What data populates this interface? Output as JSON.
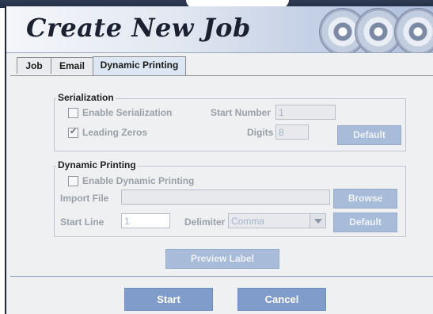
{
  "window": {
    "title": "Create New Job"
  },
  "tabs": [
    {
      "label": "Job"
    },
    {
      "label": "Email"
    },
    {
      "label": "Dynamic Printing"
    }
  ],
  "serialization": {
    "title": "Serialization",
    "enable_label": "Enable Serialization",
    "enable_checked": false,
    "start_number_label": "Start Number",
    "start_number_value": "1",
    "leading_zeros_label": "Leading Zeros",
    "leading_zeros_checked": true,
    "digits_label": "Digits",
    "digits_value": "8",
    "default_button": "Default"
  },
  "dynamic_printing": {
    "title": "Dynamic Printing",
    "enable_label": "Enable Dynamic Printing",
    "enable_checked": false,
    "import_file_label": "Import File",
    "import_file_value": "",
    "browse_button": "Browse",
    "start_line_label": "Start Line",
    "start_line_value": "1",
    "delimiter_label": "Delimiter",
    "delimiter_value": "Comma",
    "default_button": "Default"
  },
  "preview_button": "Preview Label",
  "footer": {
    "start_button": "Start",
    "cancel_button": "Cancel"
  },
  "colors": {
    "accent": "#7f9ccb",
    "banner_text": "#1b2130"
  },
  "icons": [
    "disc-icon",
    "checkbox-icon",
    "dropdown-arrow-icon"
  ]
}
